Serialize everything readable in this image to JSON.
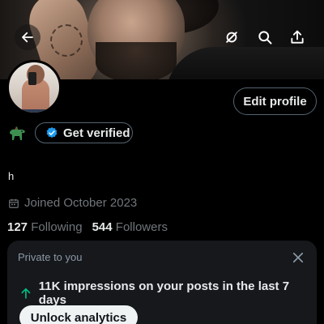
{
  "header": {
    "back_icon": "arrow-left-icon",
    "mute_icon": "eye-off-icon",
    "search_icon": "search-icon",
    "share_icon": "share-icon"
  },
  "profile": {
    "edit_profile_label": "Edit profile",
    "profile_emoji": "dog-icon",
    "get_verified_label": "Get verified",
    "bio": "h",
    "joined": "Joined October 2023",
    "following_count": "127",
    "following_label": "Following",
    "followers_count": "544",
    "followers_label": "Followers"
  },
  "analytics_card": {
    "title": "Private to you",
    "stat_text": "11K impressions on your posts in the last 7 days",
    "unlock_label": "Unlock analytics"
  },
  "colors": {
    "accent_blue": "#1d9bf0",
    "trend_green": "#00ba7c",
    "muted_text": "#71767b",
    "card_bg": "#16181c"
  }
}
